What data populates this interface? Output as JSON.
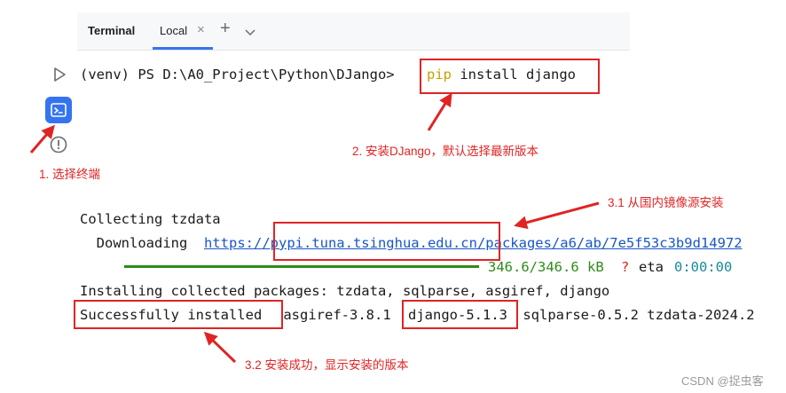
{
  "tabs": {
    "terminal": "Terminal",
    "local": "Local",
    "close_glyph": "×",
    "add_glyph": "+",
    "more_glyph": "⌄"
  },
  "terminal": {
    "prompt": "(venv) PS D:\\A0_Project\\Python\\DJango>",
    "cmd_pip": "pip",
    "cmd_rest": " install django",
    "collecting": "Collecting tzdata",
    "downloading_label": "  Downloading ",
    "download_url": "https://pypi.tuna.tsinghua.edu.cn/packages/a6/ab/7e5f53c3b9d14972",
    "progress_text": "346.6/346.6 kB",
    "progress_q": "?",
    "progress_eta_label": "eta",
    "progress_eta": "0:00:00",
    "installing": "Installing collected packages: tzdata, sqlparse, asgiref, django",
    "success": "Successfully installed",
    "pkg_asgiref": " asgiref-3.8.1 ",
    "pkg_django": "django-5.1.3",
    "pkg_rest": " sqlparse-0.5.2 tzdata-2024.2"
  },
  "annotations": {
    "step1": "1. 选择终端",
    "step2": "2. 安装DJango，默认选择最新版本",
    "step31": "3.1 从国内镜像源安装",
    "step32": "3.2 安装成功，显示安装的版本"
  },
  "watermark": "CSDN @捉虫客",
  "colors": {
    "accent": "#3574f0",
    "annotation": "#e02424",
    "progress": "#2e8b1a"
  }
}
